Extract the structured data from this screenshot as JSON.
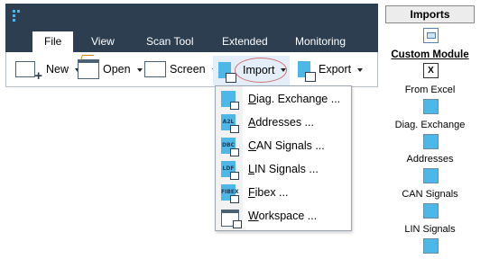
{
  "ribbon": {
    "tabs": [
      "File",
      "View",
      "Scan Tool",
      "Extended",
      "Monitoring"
    ],
    "active_tab": "File",
    "toolbar": {
      "new_label": "New",
      "open_label": "Open",
      "screen_label": "Screen",
      "import_label": "Import",
      "export_label": "Export"
    }
  },
  "import_menu": {
    "items": [
      {
        "label": "Diag. Exchange ...",
        "icon_text": "",
        "icon": "diag-exchange-file-icon"
      },
      {
        "label": "Addresses ...",
        "icon_text": "A2L",
        "icon": "a2l-file-icon"
      },
      {
        "label": "CAN Signals ...",
        "icon_text": "DBC",
        "icon": "dbc-file-icon"
      },
      {
        "label": "LIN Signals ...",
        "icon_text": "LDF",
        "icon": "ldf-file-icon"
      },
      {
        "label": "Fibex ...",
        "icon_text": "FIBEX",
        "icon": "fibex-file-icon"
      },
      {
        "label": "Workspace ...",
        "icon_text": "",
        "icon": "workspace-folder-icon"
      }
    ]
  },
  "imports_panel": {
    "title": "Imports",
    "section_header": "Custom Module",
    "items": [
      {
        "label": "From Excel",
        "icon": "excel-icon"
      },
      {
        "label": "Diag. Exchange",
        "icon": "diag-exchange-icon"
      },
      {
        "label": "Addresses",
        "icon": "addresses-icon"
      },
      {
        "label": "CAN Signals",
        "icon": "can-signals-icon"
      },
      {
        "label": "LIN Signals",
        "icon": "lin-signals-icon"
      }
    ],
    "excel_glyph": "X"
  },
  "colors": {
    "ribbon_dark": "#2c3e50",
    "accent_blue": "#4db8e8",
    "highlight_ring": "#d07070"
  }
}
